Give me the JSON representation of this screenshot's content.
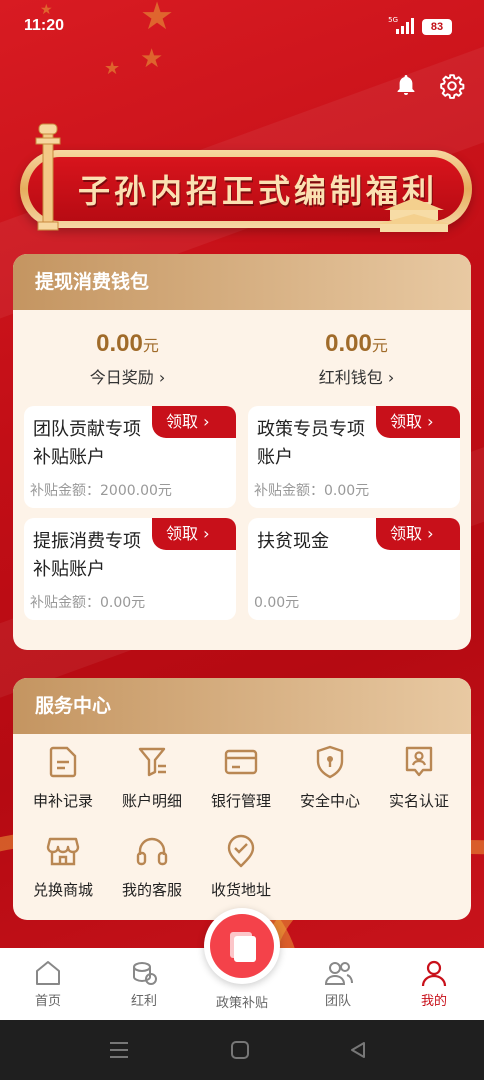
{
  "status": {
    "time": "11:20",
    "network": "5G",
    "battery": "83"
  },
  "banner": {
    "title": "子孙内招正式编制福利"
  },
  "wallet": {
    "title": "提现消费钱包",
    "today_reward": {
      "amount": "0.00",
      "unit": "元",
      "label": "今日奖励 ›"
    },
    "bonus_wallet": {
      "amount": "0.00",
      "unit": "元",
      "label": "红利钱包 ›"
    },
    "accounts": [
      {
        "name": "团队贡献专项补贴账户",
        "amount": "补贴金额：2000.00元",
        "claim": "领取 ›"
      },
      {
        "name": "政策专员专项账户",
        "amount": "补贴金额：0.00元",
        "claim": "领取 ›"
      },
      {
        "name": "提振消费专项补贴账户",
        "amount": "补贴金额：0.00元",
        "claim": "领取 ›"
      },
      {
        "name": "扶贫现金",
        "amount": "0.00元",
        "claim": "领取 ›"
      }
    ]
  },
  "service": {
    "title": "服务中心",
    "items": [
      {
        "label": "申补记录",
        "icon": "document-icon"
      },
      {
        "label": "账户明细",
        "icon": "funnel-list-icon"
      },
      {
        "label": "银行管理",
        "icon": "bank-card-icon"
      },
      {
        "label": "安全中心",
        "icon": "shield-icon"
      },
      {
        "label": "实名认证",
        "icon": "id-badge-icon"
      },
      {
        "label": "兑换商城",
        "icon": "shop-icon"
      },
      {
        "label": "我的客服",
        "icon": "headset-icon"
      },
      {
        "label": "收货地址",
        "icon": "location-check-icon"
      }
    ]
  },
  "tabs": [
    {
      "label": "首页",
      "icon": "home-icon"
    },
    {
      "label": "红利",
      "icon": "coins-icon"
    },
    {
      "label": "政策补贴",
      "icon": "book-icon"
    },
    {
      "label": "团队",
      "icon": "team-icon"
    },
    {
      "label": "我的",
      "icon": "person-icon",
      "active": true
    }
  ],
  "colors": {
    "primary_red": "#c8101a",
    "gold": "#a06b2a",
    "card_bg": "#fdf3e8"
  }
}
